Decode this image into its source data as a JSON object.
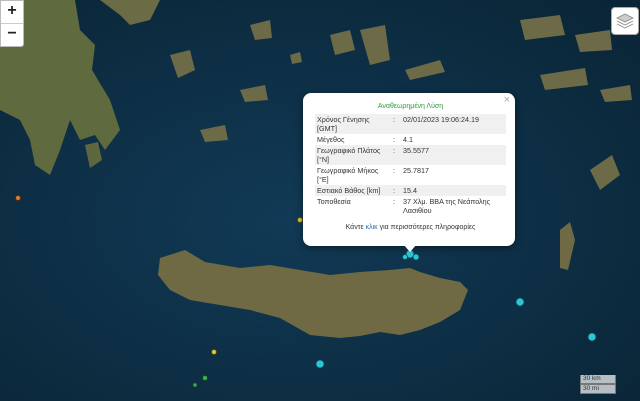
{
  "zoom": {
    "in_label": "+",
    "out_label": "−"
  },
  "popup": {
    "title": "Αναθεωρημένη Λύση",
    "close": "×",
    "rows": [
      {
        "label": "Χρόνος Γένησης [GMT]",
        "sep": ":",
        "value": "02/01/2023 19:06:24.19"
      },
      {
        "label": "Μέγεθος",
        "sep": ":",
        "value": "4.1"
      },
      {
        "label": "Γεωγραφικό Πλάτος [°N]",
        "sep": ":",
        "value": "35.5577"
      },
      {
        "label": "Γεωγραφικό Μήκος [°E]",
        "sep": ":",
        "value": "25.7817"
      },
      {
        "label": "Εστιακό Βάθος [km]",
        "sep": ":",
        "value": "15.4"
      },
      {
        "label": "Τοποθεσία",
        "sep": ":",
        "value": "37 Χλμ. ΒΒΑ της Νεάπολης Λασιθίου"
      }
    ],
    "more_pre": "Κάντε ",
    "more_link": "κλικ",
    "more_post": " για περισσότερες πληροφορίες"
  },
  "scale": {
    "km": "30 km",
    "mi": "30 mi"
  },
  "colors": {
    "sea": "#0d2f47",
    "land": "#6e6d4a",
    "marker_blue": "#2ec6d6",
    "marker_yellow": "#d8c43a",
    "marker_orange": "#e07a2a",
    "marker_green": "#3fae4f"
  },
  "icons": {
    "layers": "layers-icon",
    "close": "close-icon"
  }
}
